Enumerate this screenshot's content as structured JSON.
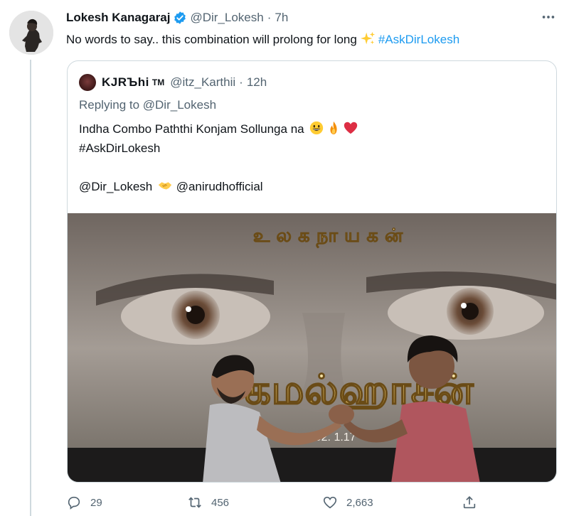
{
  "tweet": {
    "author_name": "Lokesh Kanagaraj",
    "author_handle": "@Dir_Lokesh",
    "separator": "·",
    "time": "7h",
    "text": "No words to say.. this combination will prolong for long",
    "hashtag": "#AskDirLokesh",
    "icons": {
      "verified": "verified-badge-icon",
      "more": "more-options-icon",
      "sparkle": "sparkles-emoji"
    },
    "accent_color": "#1d9bf0"
  },
  "quote": {
    "author_name": "KJRЪhi",
    "author_suffix": "TM",
    "author_handle": "@itz_Karthii",
    "separator": "·",
    "time": "12h",
    "replying_to_label": "Replying to @Dir_Lokesh",
    "text_line1": "Indha Combo Paththi Konjam Sollunga na",
    "text_line2": "#AskDirLokesh",
    "text_line3_handle1": "@Dir_Lokesh",
    "text_line3_handle2": "@anirudhofficial",
    "emojis": [
      "grinning-face-emoji",
      "fire-emoji",
      "red-heart-emoji",
      "handshake-emoji"
    ],
    "media": {
      "tamil_top": "உ ல க நா ய க ன்",
      "tamil_big": "கமல்ஹாசன்",
      "date_text": "2 02. 1.17"
    }
  },
  "actions": {
    "reply_count": "29",
    "retweet_count": "456",
    "like_count": "2,663",
    "icons": [
      "reply-icon",
      "retweet-icon",
      "like-icon",
      "share-icon"
    ]
  }
}
